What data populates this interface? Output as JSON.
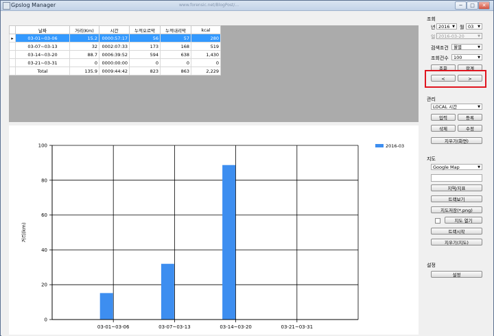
{
  "window": {
    "title": "Gpslog Manager",
    "url_hint": "www.forensic.net/BlogPost/...",
    "buttons": {
      "minimize": "─",
      "maximize": "□",
      "close": "✕"
    }
  },
  "grid": {
    "columns": [
      "날짜",
      "거리(Km)",
      "시간",
      "누적오르막",
      "누적내리막",
      "kcal"
    ],
    "rows": [
      {
        "date": "03-01~03-06",
        "dist": "15.2",
        "time": "0000:57:17",
        "up": "56",
        "down": "57",
        "kcal": "280",
        "selected": true
      },
      {
        "date": "03-07~03-13",
        "dist": "32",
        "time": "0002:07:33",
        "up": "173",
        "down": "168",
        "kcal": "519",
        "selected": false
      },
      {
        "date": "03-14~03-20",
        "dist": "88.7",
        "time": "0006:39:52",
        "up": "594",
        "down": "638",
        "kcal": "1,430",
        "selected": false
      },
      {
        "date": "03-21~03-31",
        "dist": "0",
        "time": "0000:00:00",
        "up": "0",
        "down": "0",
        "kcal": "0",
        "selected": false
      }
    ],
    "total": {
      "date": "Total",
      "dist": "135.9",
      "time": "0009:44:42",
      "up": "823",
      "down": "863",
      "kcal": "2,229"
    }
  },
  "chart_data": {
    "type": "bar",
    "categories": [
      "03-01~03-06",
      "03-07~03-13",
      "03-14~03-20",
      "03-21~03-31"
    ],
    "series": [
      {
        "name": "2016-03",
        "values": [
          15.2,
          32,
          88.7,
          0
        ],
        "color": "#3d8ef0"
      }
    ],
    "ylabel": "거리(km)",
    "ylim": [
      0,
      100
    ],
    "yticks": [
      0,
      20,
      40,
      60,
      80,
      100
    ],
    "grid": true,
    "legend": "top-right"
  },
  "side": {
    "query": {
      "section": "조회",
      "year_label": "년",
      "year_value": "2016",
      "month_label": "월",
      "month_value": "03",
      "day_label": "일",
      "day_value": "2016-03-20",
      "criteria_label": "검색조건",
      "criteria_value": "월별",
      "count_label": "조회건수",
      "count_value": "100",
      "search_btn": "조회",
      "sum_btn": "합계",
      "prev_btn": "<",
      "next_btn": ">"
    },
    "manage": {
      "section": "관리",
      "tz_value": "LOCAL 시간",
      "input_btn": "입력",
      "register_btn": "등록",
      "delete_btn": "삭제",
      "edit_btn": "수정",
      "clear_btn": "지우기(화면)"
    },
    "map": {
      "section": "지도",
      "provider_value": "Google Map",
      "search_value": "",
      "area_btn": "지역/지표",
      "track_btn": "트랙보기",
      "save_btn": "지도저장(*.png)",
      "open_label": "지도 열기",
      "track_start_btn": "트랙시작",
      "clear_map_btn": "지우기(지도)"
    },
    "settings": {
      "section": "설정",
      "settings_btn": "설정"
    }
  }
}
